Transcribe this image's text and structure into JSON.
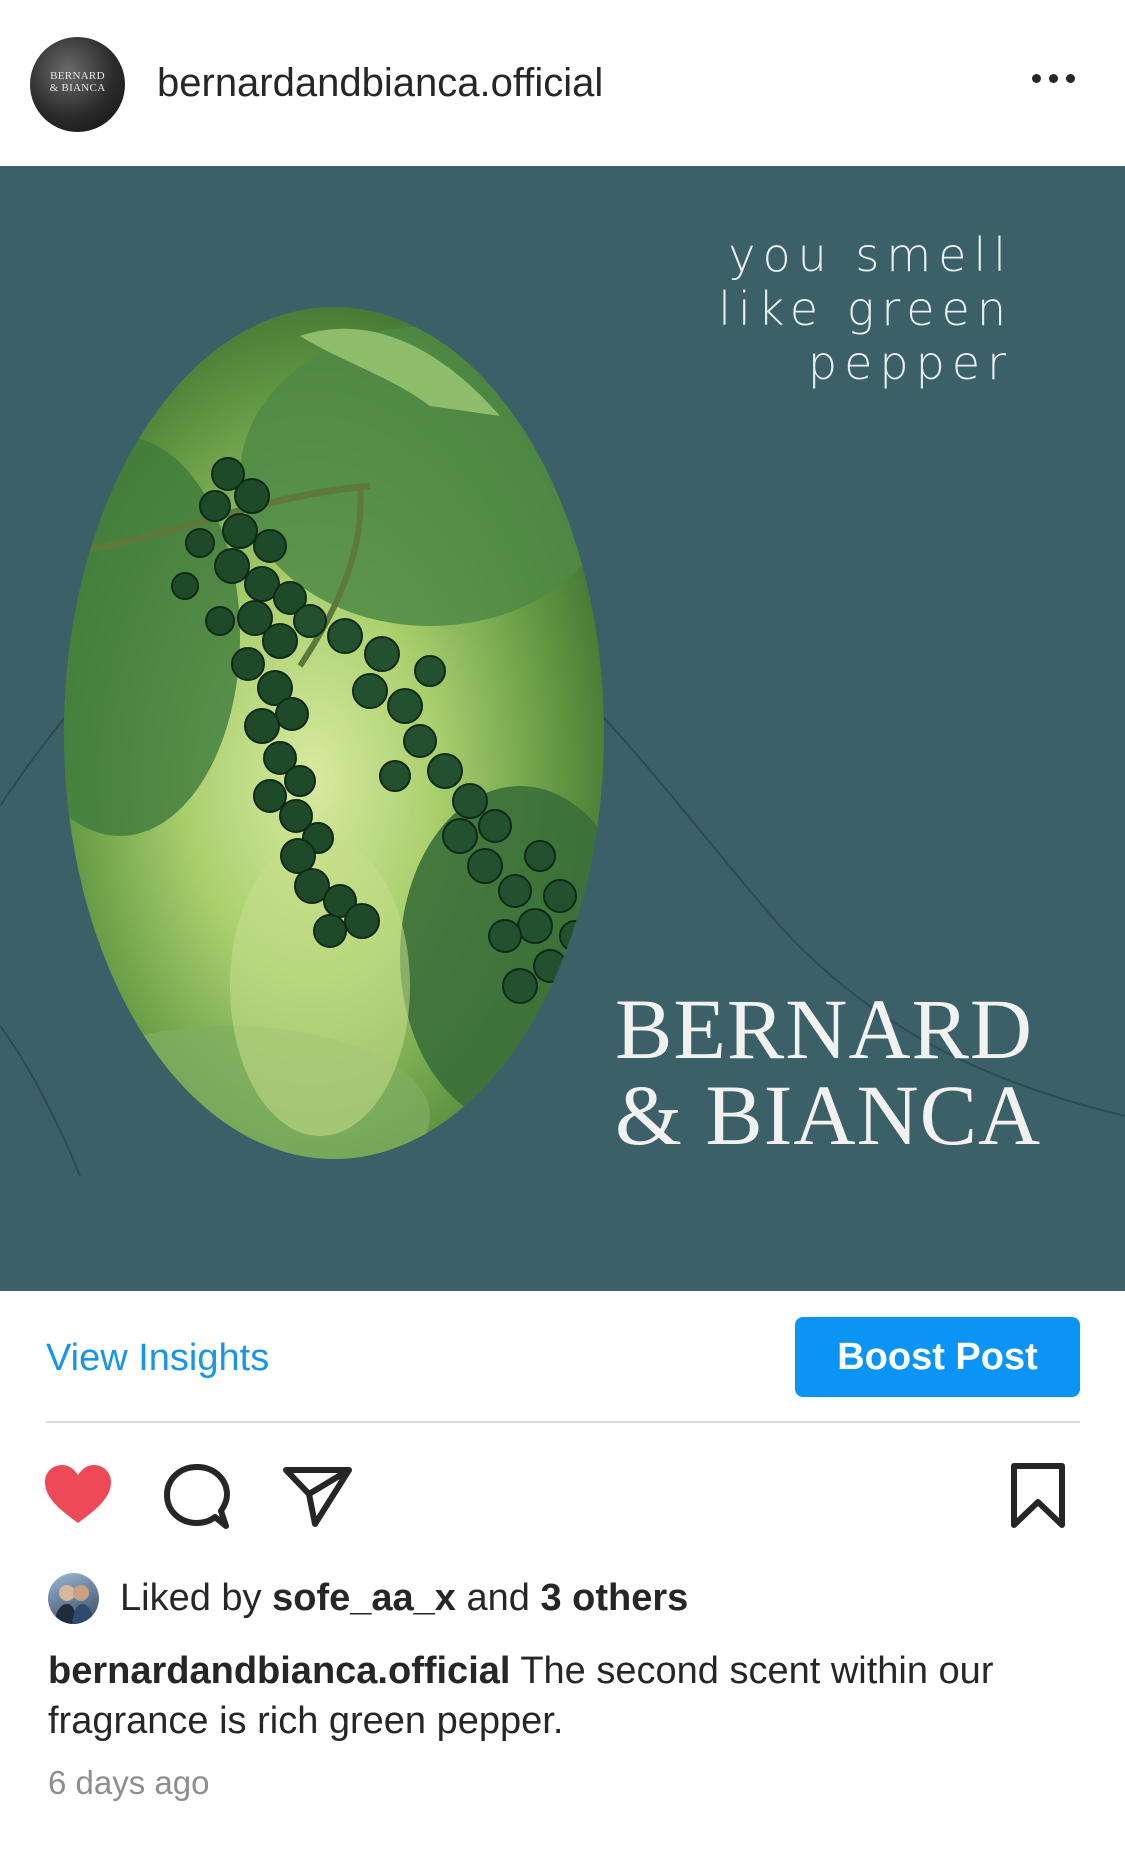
{
  "header": {
    "avatar_text_line1": "BERNARD",
    "avatar_text_line2": "& BIANCA",
    "username": "bernardandbianca.official",
    "more_icon": "more-horizontal-icon"
  },
  "post": {
    "tagline": [
      "you smell",
      "like green",
      "pepper"
    ],
    "brand": [
      "BERNARD",
      "& BIANCA"
    ],
    "background_color": "#3b6068"
  },
  "insights": {
    "view_label": "View Insights",
    "boost_label": "Boost Post",
    "accent_color": "#0a95f6"
  },
  "actions": {
    "like_icon": "heart-filled-icon",
    "comment_icon": "comment-icon",
    "share_icon": "send-icon",
    "save_icon": "bookmark-icon",
    "like_color": "#ed4956"
  },
  "likes": {
    "prefix": "Liked by",
    "user": "sofe_aa_x",
    "joiner": "and",
    "others": "3 others"
  },
  "caption": {
    "username": "bernardandbianca.official",
    "text": "The second scent within our fragrance is rich green pepper."
  },
  "timestamp": "6 days ago"
}
